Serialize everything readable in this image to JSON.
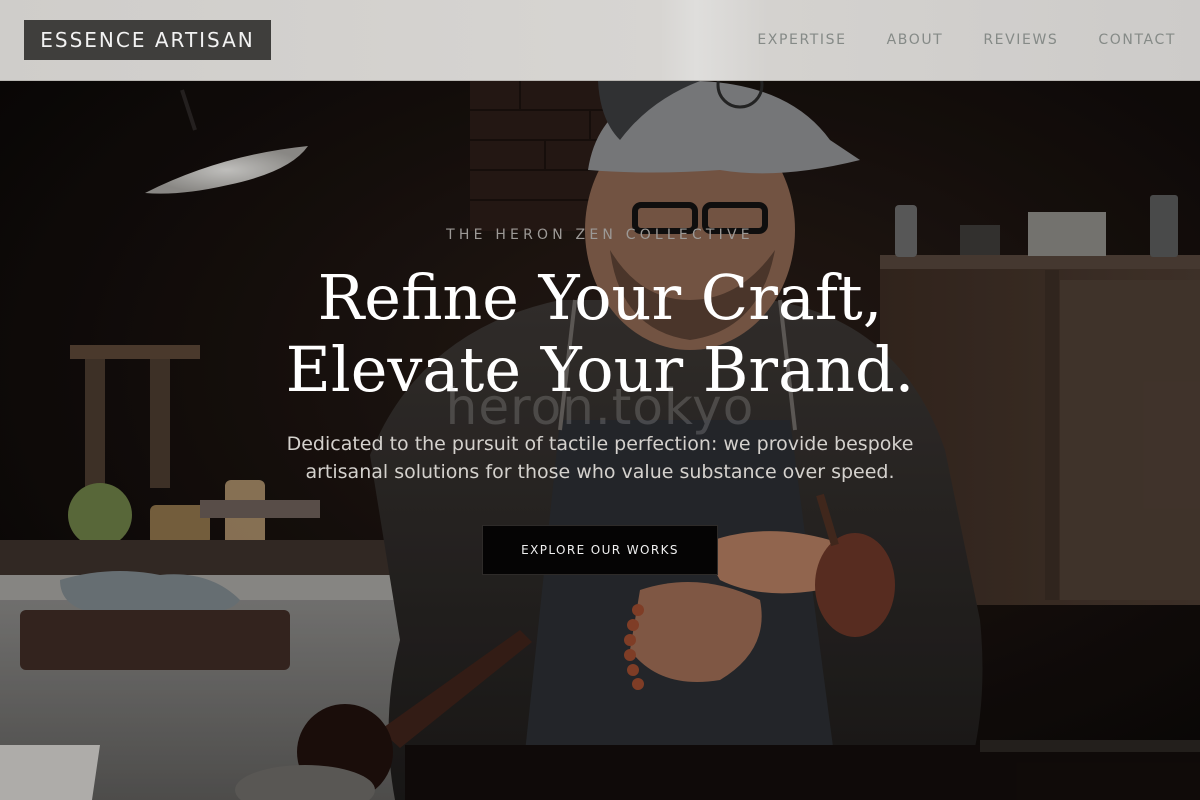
{
  "header": {
    "logo_text": "ESSENCE ARTISAN",
    "nav": [
      {
        "label": "EXPERTISE"
      },
      {
        "label": "ABOUT"
      },
      {
        "label": "REVIEWS"
      },
      {
        "label": "CONTACT"
      }
    ]
  },
  "hero": {
    "eyebrow": "THE HERON ZEN COLLECTIVE",
    "headline_line1": "Refine Your Craft,",
    "headline_line2": "Elevate Your Brand.",
    "watermark": "heron.tokyo",
    "subtext": "Dedicated to the pursuit of tactile perfection: we provide bespoke artisanal solutions for those who value substance over speed.",
    "cta_label": "EXPLORE OUR WORKS"
  },
  "colors": {
    "header_bg": "#d3d1ce",
    "logo_bg": "#3f3e3c",
    "nav_text": "#858a87",
    "cta_bg": "#050404",
    "hero_text": "#ffffff"
  }
}
